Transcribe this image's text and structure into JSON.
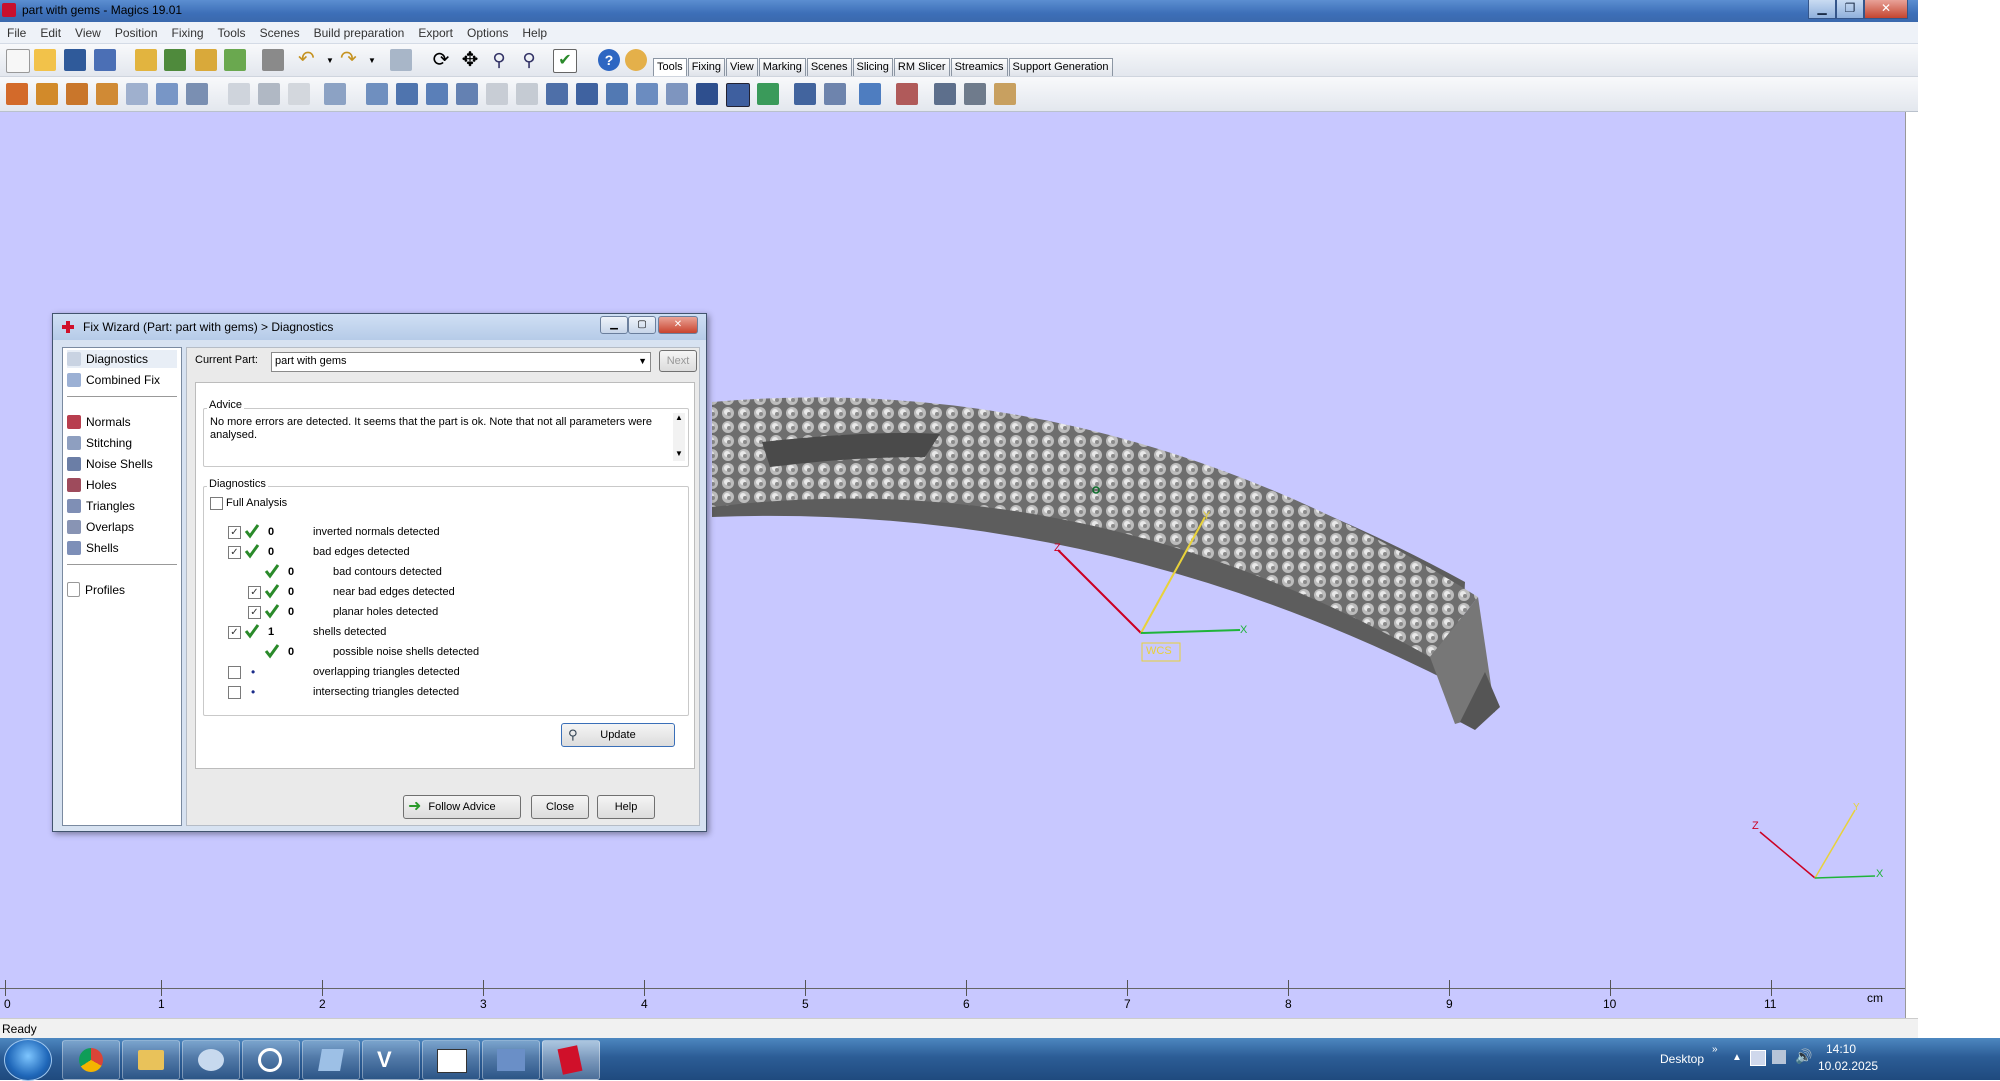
{
  "window": {
    "title": "part with gems - Magics 19.01",
    "min": "▁",
    "max": "❐",
    "close": "✕"
  },
  "menu": [
    "File",
    "Edit",
    "View",
    "Position",
    "Fixing",
    "Tools",
    "Scenes",
    "Build preparation",
    "Export",
    "Options",
    "Help"
  ],
  "toolbar_tabs": [
    "Tools",
    "Fixing",
    "View",
    "Marking",
    "Scenes",
    "Slicing",
    "RM Slicer",
    "Streamics",
    "Support Generation"
  ],
  "active_tab": "Tools",
  "dialog": {
    "title": "Fix Wizard (Part: part with gems) > Diagnostics",
    "nav": [
      "Diagnostics",
      "Combined Fix",
      "Normals",
      "Stitching",
      "Noise Shells",
      "Holes",
      "Triangles",
      "Overlaps",
      "Shells",
      "Profiles"
    ],
    "current_part_label": "Current Part:",
    "current_part_value": "part with gems",
    "next_button": "Next",
    "advice_title": "Advice",
    "advice_text": "No more errors are detected. It seems that the part is ok. Note that not all parameters were analysed.",
    "diagnostics_title": "Diagnostics",
    "full_analysis_label": "Full Analysis",
    "rows": [
      {
        "checked": true,
        "status": "ok",
        "count": "0",
        "label": "inverted normals detected",
        "indent": 0
      },
      {
        "checked": true,
        "status": "ok",
        "count": "0",
        "label": "bad edges detected",
        "indent": 0
      },
      {
        "checked": null,
        "status": "ok",
        "count": "0",
        "label": "bad contours detected",
        "indent": 1
      },
      {
        "checked": true,
        "status": "ok",
        "count": "0",
        "label": "near bad edges detected",
        "indent": 1
      },
      {
        "checked": true,
        "status": "ok",
        "count": "0",
        "label": "planar holes detected",
        "indent": 1
      },
      {
        "checked": true,
        "status": "ok",
        "count": "1",
        "label": "shells detected",
        "indent": 0
      },
      {
        "checked": null,
        "status": "ok",
        "count": "0",
        "label": "possible noise shells detected",
        "indent": 1
      },
      {
        "checked": false,
        "status": "dot",
        "count": "",
        "label": "overlapping triangles detected",
        "indent": 0
      },
      {
        "checked": false,
        "status": "dot",
        "count": "",
        "label": "intersecting triangles detected",
        "indent": 0
      }
    ],
    "update_button": "Update",
    "follow_advice_button": "Follow Advice",
    "close_button": "Close",
    "help_button": "Help"
  },
  "viewport": {
    "wcs_label": "WCS",
    "axis_x": "X",
    "axis_y": "Y",
    "axis_z": "Z",
    "ruler_ticks": [
      "0",
      "1",
      "2",
      "3",
      "4",
      "5",
      "6",
      "7",
      "8",
      "9",
      "10",
      "11"
    ],
    "ruler_unit": "cm"
  },
  "status": "Ready",
  "taskbar": {
    "desktop_label": "Desktop",
    "time": "14:10",
    "date": "10.02.2025"
  }
}
